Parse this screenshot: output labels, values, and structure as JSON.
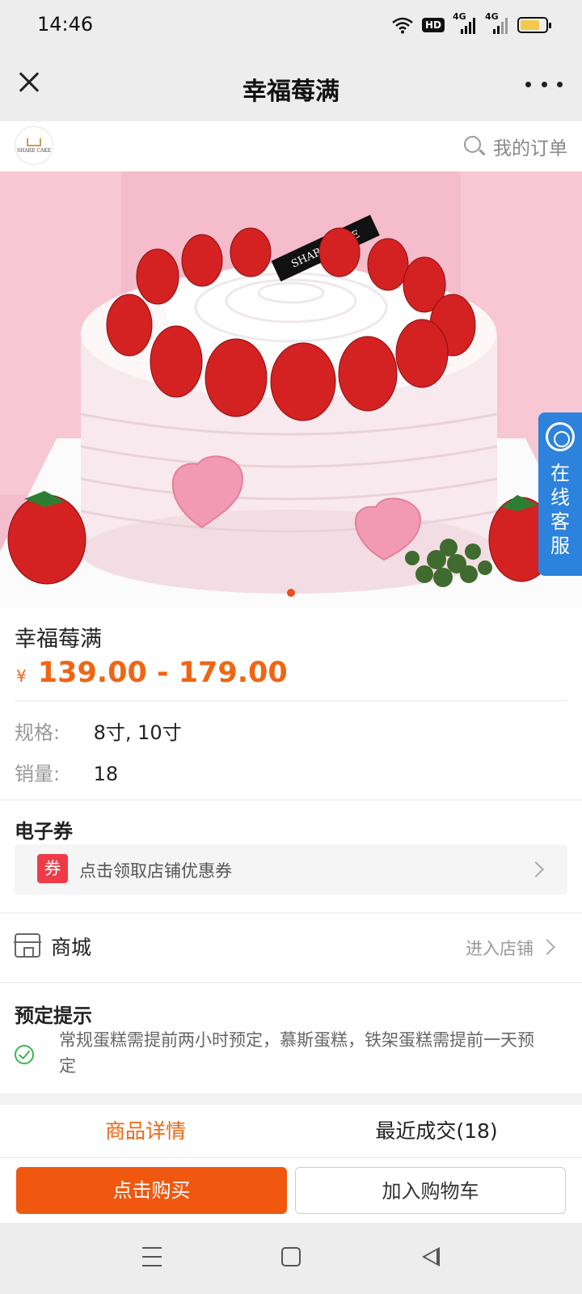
{
  "status_bar": {
    "time": "14:46",
    "network_badge": "HD",
    "signal_1_label": "4G",
    "signal_2_label": "4G",
    "battery_level_percent": 75
  },
  "nav": {
    "title": "幸福莓满",
    "icons": [
      "close-icon",
      "more-icon"
    ]
  },
  "shop": {
    "logo_text": "SHARE CAKE",
    "orders_label": "我的订单"
  },
  "hero": {
    "cake_topper_text": "SHARE CAKE",
    "carousel_count": 1,
    "carousel_active_index": 0
  },
  "online_service": {
    "label": "在线客服"
  },
  "product": {
    "name": "幸福莓满",
    "currency": "¥",
    "price_range": "139.00 - 179.00",
    "spec_label": "规格:",
    "spec_value": "8寸, 10寸",
    "sales_label": "销量:",
    "sales_value": "18"
  },
  "coupon": {
    "heading": "电子券",
    "tag": "券",
    "text": "点击领取店铺优惠券"
  },
  "mall": {
    "label": "商城",
    "enter": "进入店铺"
  },
  "notice": {
    "heading": "预定提示",
    "text": "常规蛋糕需提前两小时预定，慕斯蛋糕，铁架蛋糕需提前一天预定"
  },
  "tabs": {
    "detail": "商品详情",
    "recent": "最近成交(18)",
    "active": "detail"
  },
  "actions": {
    "buy": "点击购买",
    "cart": "加入购物车"
  },
  "colors": {
    "accent": "#f06513",
    "buy_button": "#f0580f",
    "coupon_tag": "#ef3b47",
    "service_blue": "#2d82dc",
    "check_green": "#3fb44e"
  }
}
